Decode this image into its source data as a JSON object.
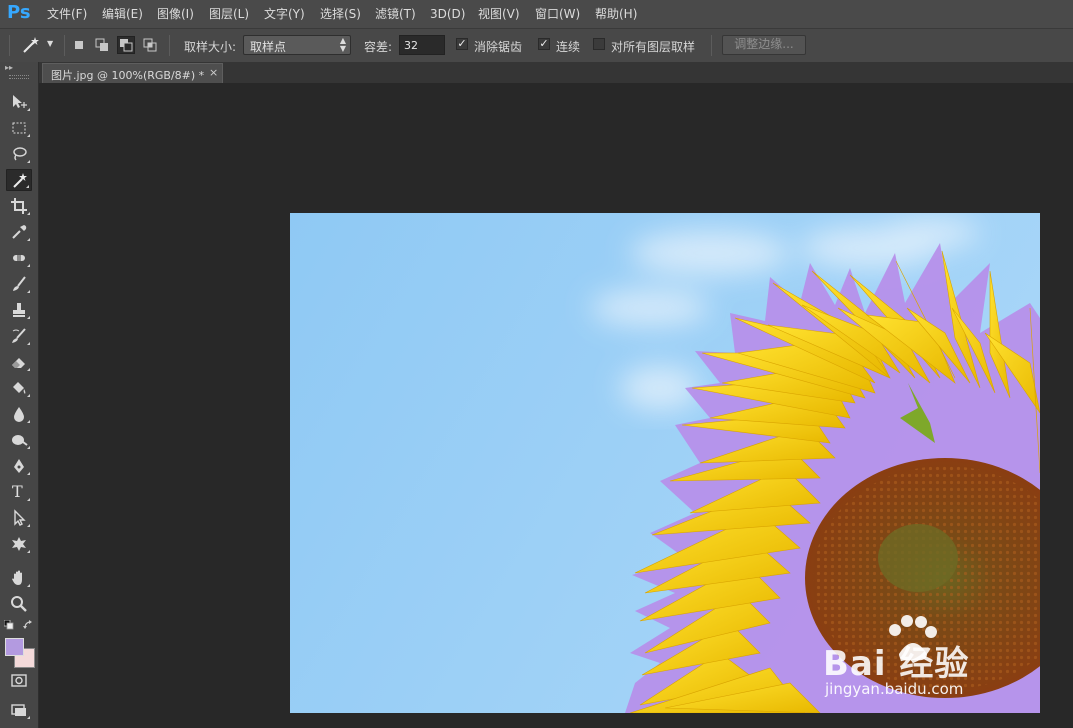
{
  "app": {
    "logo": "Ps"
  },
  "menu": [
    {
      "label": "文件(F)"
    },
    {
      "label": "编辑(E)"
    },
    {
      "label": "图像(I)"
    },
    {
      "label": "图层(L)"
    },
    {
      "label": "文字(Y)"
    },
    {
      "label": "选择(S)"
    },
    {
      "label": "滤镜(T)"
    },
    {
      "label": "3D(D)"
    },
    {
      "label": "视图(V)"
    },
    {
      "label": "窗口(W)"
    },
    {
      "label": "帮助(H)"
    }
  ],
  "options": {
    "tool_icon": "magic-wand-icon",
    "selection_modes": [
      "new-selection",
      "add-to-selection",
      "subtract-from-selection",
      "intersect-with-selection"
    ],
    "active_mode": "subtract-from-selection",
    "sample_size_label": "取样大小:",
    "sample_size_value": "取样点",
    "tolerance_label": "容差:",
    "tolerance_value": "32",
    "anti_alias_label": "消除锯齿",
    "anti_alias_checked": true,
    "contiguous_label": "连续",
    "contiguous_checked": true,
    "sample_all_layers_label": "对所有图层取样",
    "sample_all_layers_checked": false,
    "refine_edge_label": "调整边缘..."
  },
  "tools": [
    {
      "name": "move-tool",
      "icon": "move-icon"
    },
    {
      "name": "rectangular-marquee-tool",
      "icon": "marquee-icon"
    },
    {
      "name": "lasso-tool",
      "icon": "lasso-icon"
    },
    {
      "name": "magic-wand-tool",
      "icon": "magic-wand-icon",
      "active": true
    },
    {
      "name": "crop-tool",
      "icon": "crop-icon"
    },
    {
      "name": "eyedropper-tool",
      "icon": "eyedropper-icon"
    },
    {
      "name": "healing-brush-tool",
      "icon": "bandage-icon"
    },
    {
      "name": "brush-tool",
      "icon": "brush-icon"
    },
    {
      "name": "clone-stamp-tool",
      "icon": "stamp-icon"
    },
    {
      "name": "history-brush-tool",
      "icon": "history-brush-icon"
    },
    {
      "name": "eraser-tool",
      "icon": "eraser-icon"
    },
    {
      "name": "paint-bucket-tool",
      "icon": "bucket-icon"
    },
    {
      "name": "blur-tool",
      "icon": "drop-icon"
    },
    {
      "name": "dodge-tool",
      "icon": "dodge-icon"
    },
    {
      "name": "pen-tool",
      "icon": "pen-icon"
    },
    {
      "name": "type-tool",
      "icon": "type-icon",
      "glyph": "T"
    },
    {
      "name": "path-selection-tool",
      "icon": "arrow-icon"
    },
    {
      "name": "custom-shape-tool",
      "icon": "shape-icon"
    },
    {
      "name": "hand-tool",
      "icon": "hand-icon"
    },
    {
      "name": "zoom-tool",
      "icon": "zoom-icon"
    }
  ],
  "colors": {
    "foreground": "#b39ae0",
    "background": "#f4dada",
    "selection_outline": "#b690ea",
    "sky": "#9ccff6"
  },
  "document": {
    "tab_title": "图片.jpg @ 100%(RGB/8#) *",
    "close_glyph": "×"
  },
  "watermark": {
    "text_1": "Bai  经验",
    "text_2": "jingyan.baidu.com"
  }
}
